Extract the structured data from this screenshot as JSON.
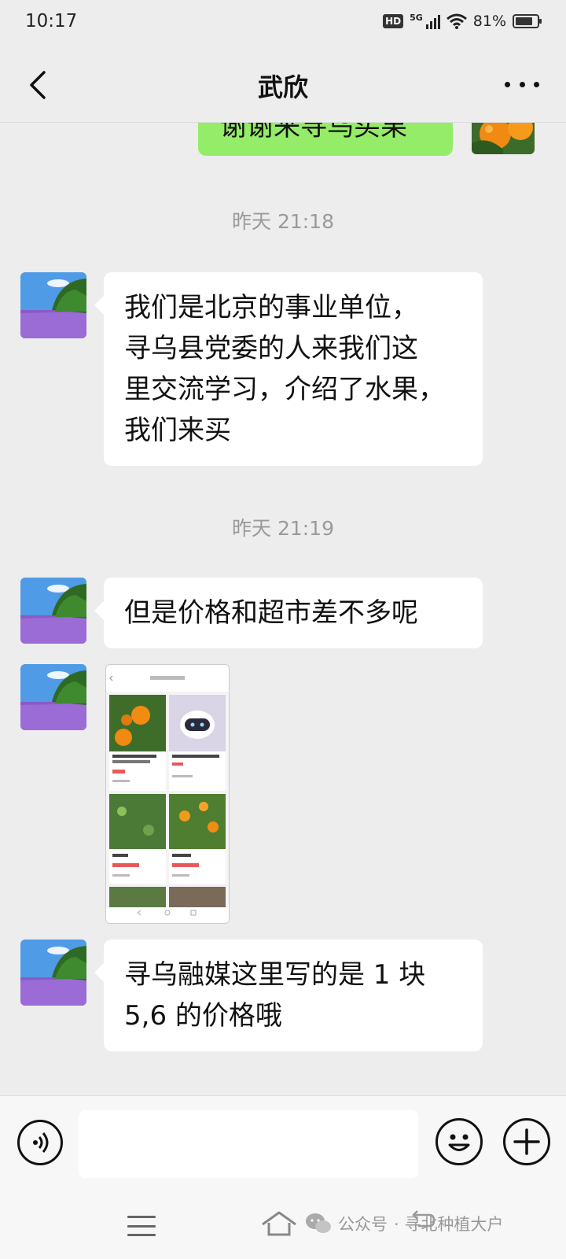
{
  "status_bar": {
    "time": "10:17",
    "hd": "HD",
    "network": "5G",
    "battery": "81%",
    "battery_level": 0.81
  },
  "header": {
    "title": "武欣"
  },
  "messages": {
    "sent_partial": "谢谢来寻乌买果",
    "time1": "昨天 21:18",
    "msg1": [
      "我们是北京的事业单位，",
      "寻乌县党委的人来我们这",
      "里交流学习，介绍了水果，",
      "我们来买"
    ],
    "time2": "昨天 21:19",
    "msg2": "但是价格和超市差不多呢",
    "msg4": [
      "寻乌融媒这里写的是 1 块",
      "5,6 的价格哦"
    ]
  },
  "watermark": {
    "label": "公众号",
    "name": "· 寻北种植大户"
  },
  "colors": {
    "background": "#ededed",
    "sent_bubble": "#95ec69",
    "received_bubble": "#ffffff",
    "timestamp": "#9a9a9a"
  }
}
